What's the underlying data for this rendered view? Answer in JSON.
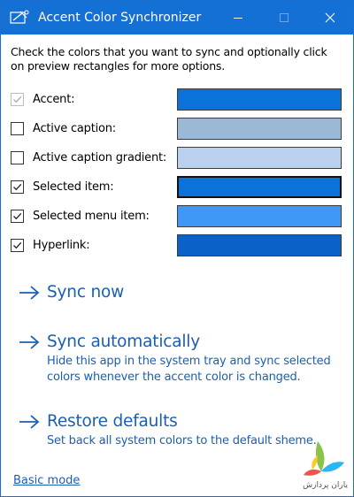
{
  "window": {
    "title": "Accent Color Synchronizer",
    "accent_color": "#1570d6"
  },
  "instructions": "Check the colors that you want to sync and optionally click on preview rectangles for more options.",
  "color_options": [
    {
      "label": "Accent:",
      "checked": true,
      "enabled": false,
      "color": "#0a72d8"
    },
    {
      "label": "Active caption:",
      "checked": false,
      "enabled": true,
      "color": "#9db8d7"
    },
    {
      "label": "Active caption gradient:",
      "checked": false,
      "enabled": true,
      "color": "#b9d1ec"
    },
    {
      "label": "Selected item:",
      "checked": true,
      "enabled": true,
      "color": "#0a72d8"
    },
    {
      "label": "Selected menu item:",
      "checked": true,
      "enabled": true,
      "color": "#3f97f6"
    },
    {
      "label": "Hyperlink:",
      "checked": true,
      "enabled": true,
      "color": "#0a62c8"
    }
  ],
  "actions": {
    "sync_now": {
      "label": "Sync now"
    },
    "sync_auto": {
      "label": "Sync automatically",
      "description": "Hide this app in the system tray and sync selected colors whenever the accent color is changed."
    },
    "restore": {
      "label": "Restore defaults",
      "description": "Set back all system colors to the default sheme."
    }
  },
  "basic_mode_link": "Basic mode",
  "icons": {
    "app": "palette-icon",
    "minimize": "minimize-icon",
    "maximize": "maximize-icon",
    "close": "close-icon",
    "arrow": "arrow-right-icon"
  },
  "watermark_text": "یاران پردازش",
  "link_color": "#1a5fb4"
}
